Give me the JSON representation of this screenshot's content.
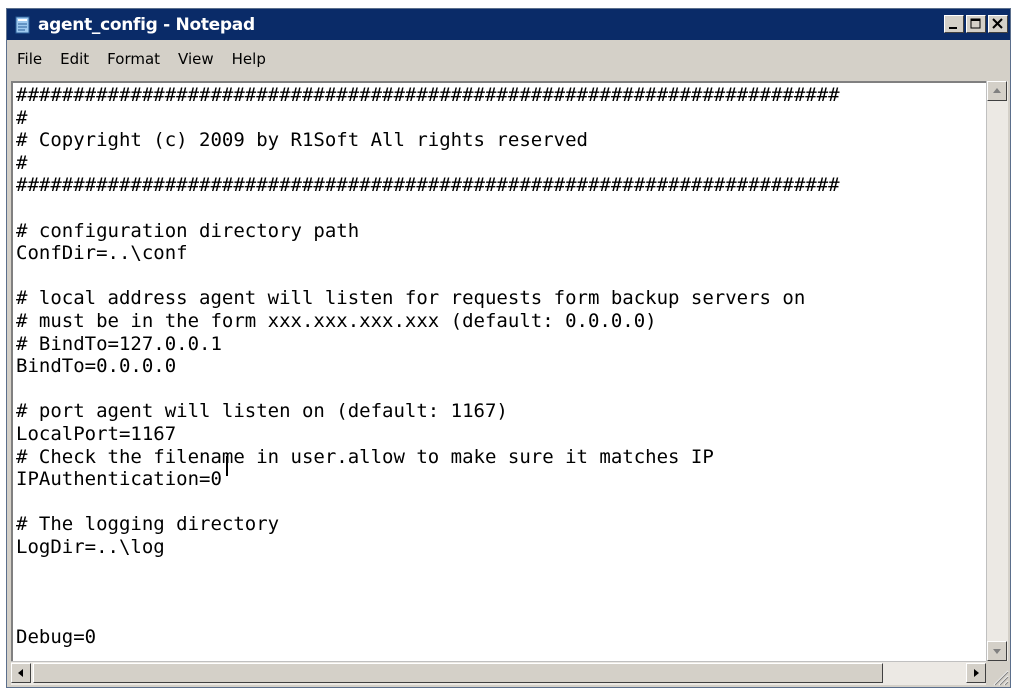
{
  "window": {
    "title": "agent_config - Notepad",
    "icon": "notepad-icon",
    "controls": [
      "minimize-icon",
      "maximize-icon",
      "close-icon"
    ]
  },
  "menu": {
    "items": [
      {
        "label": "File"
      },
      {
        "label": "Edit"
      },
      {
        "label": "Format"
      },
      {
        "label": "View"
      },
      {
        "label": "Help"
      }
    ]
  },
  "editor": {
    "text": "########################################################################\n#\n# Copyright (c) 2009 by R1Soft All rights reserved\n#\n########################################################################\n\n# configuration directory path\nConfDir=..\\conf\n\n# local address agent will listen for requests form backup servers on\n# must be in the form xxx.xxx.xxx.xxx (default: 0.0.0.0)\n# BindTo=127.0.0.1\nBindTo=0.0.0.0\n\n# port agent will listen on (default: 1167)\nLocalPort=1167\n# Check the filename in user.allow to make sure it matches IP\nIPAuthentication=0\n\n# The logging directory\nLogDir=..\\log\n\n\n\nDebug=0"
  },
  "colors": {
    "titlebar": "#0a2b68",
    "chrome": "#d4d0c8",
    "editor_bg": "#ffffff"
  }
}
